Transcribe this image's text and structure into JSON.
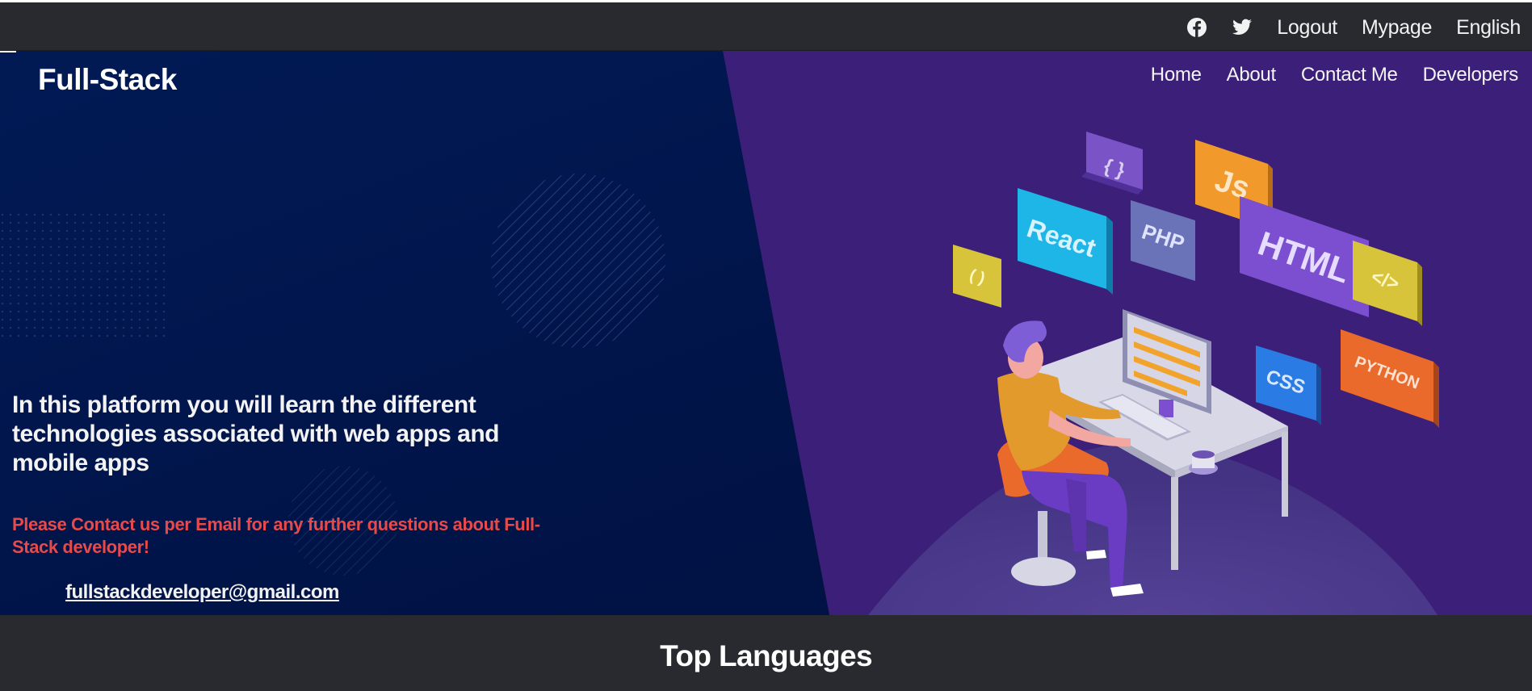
{
  "topbar": {
    "icons": [
      "facebook-icon",
      "twitter-icon"
    ],
    "links": {
      "logout": "Logout",
      "mypage": "Mypage",
      "language": "English"
    }
  },
  "hero": {
    "brand": "Full-Stack",
    "nav": {
      "home": "Home",
      "about": "About",
      "contact": "Contact Me",
      "developers": "Developers"
    },
    "headline": "In this platform you will learn the different technologies associated with web apps and mobile apps",
    "contact_message": "Please Contact us per Email for any further questions about Full-Stack developer!",
    "email": "fullstackdeveloper@gmail.com",
    "tech_labels": [
      "{ }",
      "Js",
      "React",
      "PHP",
      "HTML",
      "</>",
      "( )",
      "CSS",
      "PYTHON"
    ],
    "colors": {
      "dark_bg": "#01164d",
      "purple_bg": "#3b1f78",
      "accent_red": "#e84a4a"
    }
  },
  "section": {
    "title": "Top Languages"
  }
}
